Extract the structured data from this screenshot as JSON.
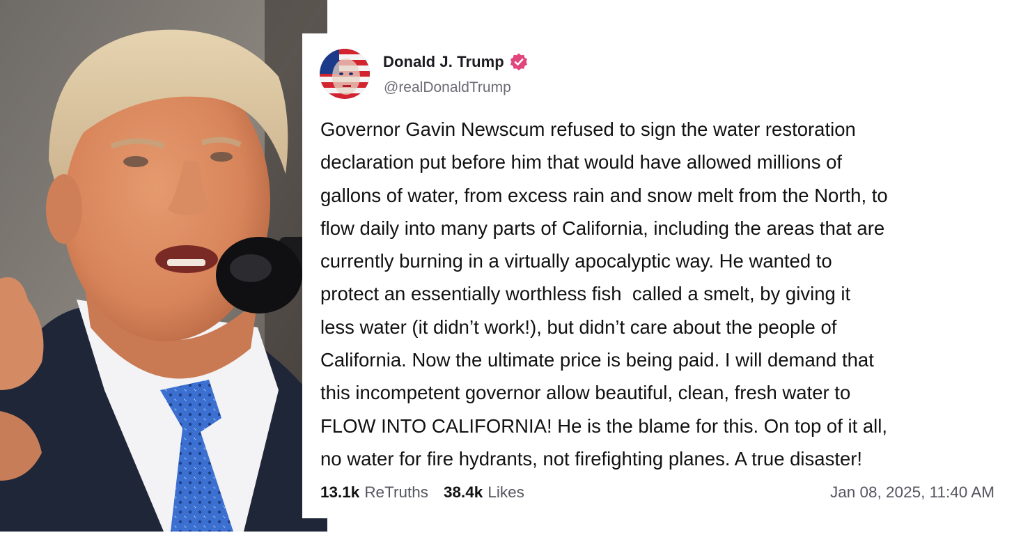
{
  "colors": {
    "verified_badge": "#e0457b",
    "background": "#ffffff",
    "text_primary": "#111111",
    "text_secondary": "#55555f"
  },
  "post": {
    "author": {
      "display_name": "Donald J. Trump",
      "handle": "@realDonaldTrump",
      "verified_icon": "verified-badge-icon"
    },
    "body_lines": [
      "Governor Gavin Newscum refused to sign the water restoration",
      "declaration put before him that would have allowed millions of",
      "gallons of water, from excess rain and snow melt from the North, to",
      "flow daily into many parts of California, including the areas that are",
      "currently burning in a virtually apocalyptic way. He wanted to",
      "protect an essentially worthless fish  called a smelt, by giving it",
      "less water (it didn’t work!), but didn’t care about the people of",
      "California. Now the ultimate price is being paid. I will demand that",
      "this incompetent governor allow beautiful, clean, fresh water to",
      "FLOW INTO CALIFORNIA! He is the blame for this. On top of it all,",
      "no water for fire hydrants, not firefighting planes. A true disaster!"
    ],
    "stats": {
      "retruths_count": "13.1k",
      "retruths_label": "ReTruths",
      "likes_count": "38.4k",
      "likes_label": "Likes"
    },
    "timestamp": "Jan 08, 2025, 11:40 AM"
  }
}
